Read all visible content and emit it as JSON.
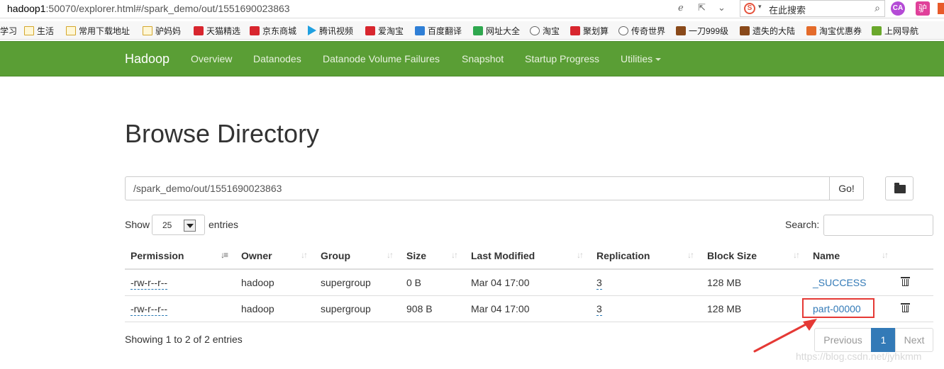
{
  "browser": {
    "url_host": "hadoop1",
    "url_rest": ":50070/explorer.html#/spark_demo/out/1551690023863",
    "search_placeholder": "在此搜索",
    "search_engine_icon": "sogou-search-icon",
    "ext1_label": "CA",
    "ext2_label": "驴"
  },
  "bookmarks": [
    {
      "label": "学习",
      "icon": "none"
    },
    {
      "label": "生活",
      "icon": "folder"
    },
    {
      "label": "常用下载地址",
      "icon": "folder"
    },
    {
      "label": "驴妈妈",
      "icon": "folder"
    },
    {
      "label": "天猫精选",
      "icon": "red"
    },
    {
      "label": "京东商城",
      "icon": "red"
    },
    {
      "label": "腾讯视频",
      "icon": "play"
    },
    {
      "label": "爱淘宝",
      "icon": "red"
    },
    {
      "label": "百度翻译",
      "icon": "blue"
    },
    {
      "label": "网址大全",
      "icon": "green"
    },
    {
      "label": "淘宝",
      "icon": "globe"
    },
    {
      "label": "聚划算",
      "icon": "red"
    },
    {
      "label": "传奇世界",
      "icon": "globe"
    },
    {
      "label": "一刀999级",
      "icon": "dark"
    },
    {
      "label": "遗失的大陆",
      "icon": "dark"
    },
    {
      "label": "淘宝优惠券",
      "icon": "orange"
    },
    {
      "label": "上网导航",
      "icon": "grn2"
    }
  ],
  "navbar": {
    "brand": "Hadoop",
    "items": [
      "Overview",
      "Datanodes",
      "Datanode Volume Failures",
      "Snapshot",
      "Startup Progress",
      "Utilities"
    ]
  },
  "page": {
    "title": "Browse Directory",
    "path": "/spark_demo/out/1551690023863",
    "go_label": "Go!",
    "show_label": "Show",
    "page_length": "25",
    "entries_label": "entries",
    "search_label": "Search:",
    "search_value": ""
  },
  "table": {
    "columns": [
      "Permission",
      "Owner",
      "Group",
      "Size",
      "Last Modified",
      "Replication",
      "Block Size",
      "Name"
    ],
    "rows": [
      {
        "permission": "-rw-r--r--",
        "owner": "hadoop",
        "group": "supergroup",
        "size": "0 B",
        "modified": "Mar 04 17:00",
        "replication": "3",
        "block_size": "128 MB",
        "name": "_SUCCESS"
      },
      {
        "permission": "-rw-r--r--",
        "owner": "hadoop",
        "group": "supergroup",
        "size": "908 B",
        "modified": "Mar 04 17:00",
        "replication": "3",
        "block_size": "128 MB",
        "name": "part-00000"
      }
    ]
  },
  "footer": {
    "info": "Showing 1 to 2 of 2 entries",
    "previous": "Previous",
    "current_page": "1",
    "next": "Next",
    "watermark": "https://blog.csdn.net/jyhkmm"
  },
  "colors": {
    "navbar": "#5a9e35",
    "link": "#337ab7",
    "highlight": "#e53935"
  }
}
